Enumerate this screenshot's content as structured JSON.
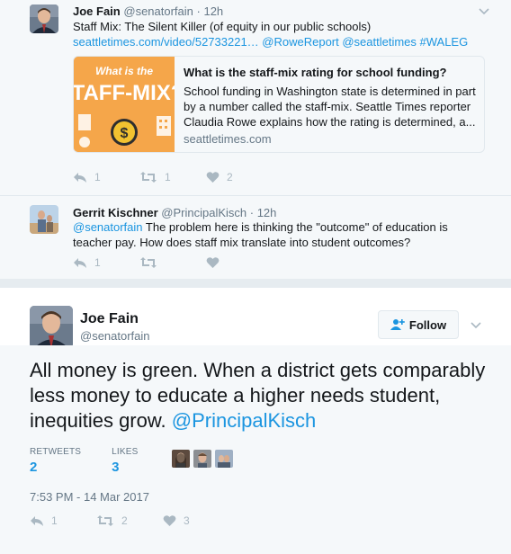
{
  "tweet1": {
    "name": "Joe Fain",
    "handle": "@senatorfain",
    "time": "· 12h",
    "text": "Staff Mix: The Silent Killer (of equity in our public schools)",
    "links": "seattletimes.com/video/52733221… @RoweReport @seattletimes #WALEG",
    "card": {
      "image_text_top": "What is the",
      "image_text_big": "STAFF-MIX?",
      "title": "What is the staff-mix rating for school funding?",
      "description": "School funding in Washington state is determined in part by a number called the staff-mix. Seattle Times reporter Claudia Rowe explains how the rating is determined, a...",
      "domain": "seattletimes.com"
    },
    "replies": "1",
    "retweets": "1",
    "likes": "2"
  },
  "tweet2": {
    "name": "Gerrit Kischner",
    "handle": "@PrincipalKisch",
    "time": "· 12h",
    "mention": "@senatorfain",
    "text": " The problem here is thinking the \"outcome\" of education is teacher pay. How does staff mix translate into student outcomes?",
    "replies": "1",
    "retweets": "",
    "likes": ""
  },
  "main": {
    "name": "Joe Fain",
    "handle": "@senatorfain",
    "follow_label": "Follow",
    "text": "All money is green. When a district gets comparably less money to educate a higher needs student, inequities grow. ",
    "mention": "@PrincipalKisch",
    "retweets_label": "RETWEETS",
    "retweets_count": "2",
    "likes_label": "LIKES",
    "likes_count": "3",
    "timestamp": "7:53 PM - 14 Mar 2017",
    "replies": "1",
    "retweets": "2",
    "likes": "3"
  },
  "colors": {
    "link": "#1b95e0",
    "muted": "#657786",
    "icon": "#aab8c2",
    "card_image": "#f5a64a"
  }
}
